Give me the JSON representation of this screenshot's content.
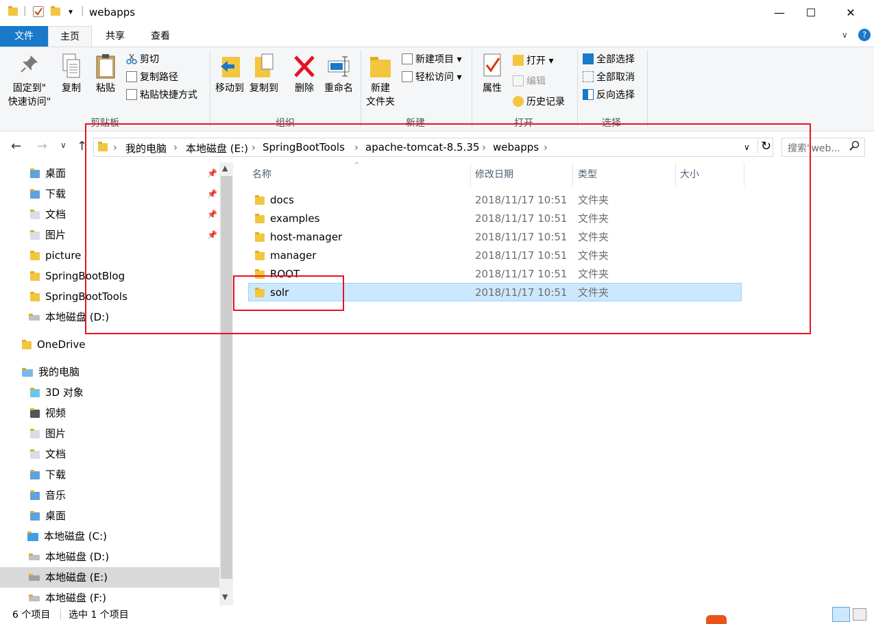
{
  "window": {
    "title": "webapps",
    "minimize": "—",
    "maximize": "☐",
    "close": "✕",
    "qa_dropdown": "▾"
  },
  "tabs": [
    {
      "label": "文件"
    },
    {
      "label": "主页"
    },
    {
      "label": "共享"
    },
    {
      "label": "查看"
    }
  ],
  "ribbon": {
    "clipboard": {
      "label": "剪贴板",
      "pin_line1": "固定到\"",
      "pin_line2": "快速访问\"",
      "copy": "复制",
      "paste": "粘贴",
      "cut": "剪切",
      "copy_path": "复制路径",
      "paste_shortcut": "粘贴快捷方式"
    },
    "organize": {
      "label": "组织",
      "move_to": "移动到",
      "copy_to": "复制到",
      "delete": "删除",
      "rename": "重命名"
    },
    "new": {
      "label": "新建",
      "new_folder_line1": "新建",
      "new_folder_line2": "文件夹",
      "new_item": "新建项目 ▾",
      "easy_access": "轻松访问 ▾"
    },
    "open": {
      "label": "打开",
      "properties": "属性",
      "open": "打开 ▾",
      "edit": "编辑",
      "history": "历史记录"
    },
    "select": {
      "label": "选择",
      "select_all": "全部选择",
      "select_none": "全部取消",
      "invert": "反向选择"
    }
  },
  "address": {
    "crumbs": [
      "我的电脑",
      "本地磁盘 (E:)",
      "SpringBootTools",
      "apache-tomcat-8.5.35",
      "webapps"
    ],
    "search_placeholder": "搜索\"web...",
    "back": "←",
    "forward": "→",
    "recent": "∨",
    "up": "↑",
    "refresh": "↻",
    "dropdown": "∨"
  },
  "nav": {
    "quick": [
      "桌面",
      "下载",
      "文档",
      "图片",
      "picture",
      "SpringBootBlog",
      "SpringBootTools",
      "本地磁盘 (D:)"
    ],
    "onedrive": "OneDrive",
    "thispc": "我的电脑",
    "pc_items": [
      "3D 对象",
      "视频",
      "图片",
      "文档",
      "下载",
      "音乐",
      "桌面",
      "本地磁盘 (C:)",
      "本地磁盘 (D:)",
      "本地磁盘 (E:)",
      "本地磁盘 (F:)"
    ]
  },
  "columns": {
    "name": "名称",
    "date": "修改日期",
    "type": "类型",
    "size": "大小"
  },
  "files": [
    {
      "name": "docs",
      "date": "2018/11/17 10:51",
      "type": "文件夹"
    },
    {
      "name": "examples",
      "date": "2018/11/17 10:51",
      "type": "文件夹"
    },
    {
      "name": "host-manager",
      "date": "2018/11/17 10:51",
      "type": "文件夹"
    },
    {
      "name": "manager",
      "date": "2018/11/17 10:51",
      "type": "文件夹"
    },
    {
      "name": "ROOT",
      "date": "2018/11/17 10:51",
      "type": "文件夹"
    },
    {
      "name": "solr",
      "date": "2018/11/17 10:51",
      "type": "文件夹"
    }
  ],
  "status": {
    "count": "6 个项目",
    "selected": "选中 1 个项目"
  },
  "colors": {
    "accent": "#1979ca",
    "selection": "#cce8ff",
    "annotation": "#e81123",
    "folder": "#f3c640"
  }
}
